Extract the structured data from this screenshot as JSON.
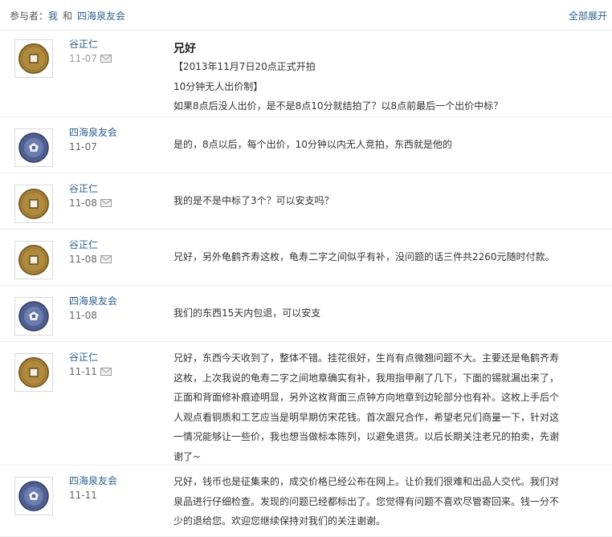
{
  "header": {
    "participants_label": "参与者：",
    "participant_me": "我",
    "and_text": "和",
    "participant_other": "四海泉友会",
    "expand_all": "全部展开"
  },
  "messages": [
    {
      "author": "谷正仁",
      "date": "11-07",
      "avatar": "coin-avatar",
      "has_mail_icon": true,
      "subject": "兄好",
      "lines": [
        "【2013年11月7日20点正式开拍",
        "10分钟无人出价制】",
        "如果8点后没人出价，是不是8点10分就结拍了？以8点前最后一个出价中标？"
      ]
    },
    {
      "author": "四海泉友会",
      "date": "11-07",
      "avatar": "club-logo-avatar",
      "has_mail_icon": false,
      "lines": [
        "是的，8点以后，每个出价，10分钟以内无人竞拍，东西就是他的"
      ]
    },
    {
      "author": "谷正仁",
      "date": "11-08",
      "avatar": "coin-avatar",
      "has_mail_icon": true,
      "lines": [
        "我的是不是中标了3个？可以安支吗？"
      ]
    },
    {
      "author": "谷正仁",
      "date": "11-08",
      "avatar": "coin-avatar",
      "has_mail_icon": true,
      "lines": [
        "兄好，另外龟鹤齐寿这枚，龟寿二字之间似乎有补，没问题的话三件共2260元随时付款。"
      ]
    },
    {
      "author": "四海泉友会",
      "date": "11-08",
      "avatar": "club-logo-avatar",
      "has_mail_icon": false,
      "lines": [
        "我们的东西15天内包退，可以安支"
      ]
    },
    {
      "author": "谷正仁",
      "date": "11-11",
      "avatar": "coin-avatar",
      "has_mail_icon": true,
      "lines": [
        "兄好，东西今天收到了，整体不错。挂花很好，生肖有点微翘问题不大。主要还是龟鹤齐寿",
        "这枚，上次我说的龟寿二字之间地章确实有补，我用指甲剐了几下，下面的锡就漏出来了，",
        "正面和背面修补痕迹明显，另外这枚背面三点钟方向地章到边轮部分也有补。这枚上手后个",
        "人观点看铜质和工艺应当是明早期仿宋花钱。首次跟兄合作，希望老兄们商量一下，针对这",
        "一情况能够让一些价，我也想当做标本陈列，以避免退货。以后长期关注老兄的拍卖，先谢",
        "谢了~"
      ]
    },
    {
      "author": "四海泉友会",
      "date": "11-11",
      "avatar": "club-logo-avatar",
      "has_mail_icon": false,
      "lines": [
        "兄好，钱币也是征集来的，成交价格已经公布在网上。让价我们很难和出品人交代。我们对",
        "泉品进行仔细检查。发现的问题已经都标出了。您觉得有问题不喜欢尽管寄回来。钱一分不",
        "少的退给您。欢迎您继续保持对我们的关注谢谢。"
      ]
    }
  ]
}
